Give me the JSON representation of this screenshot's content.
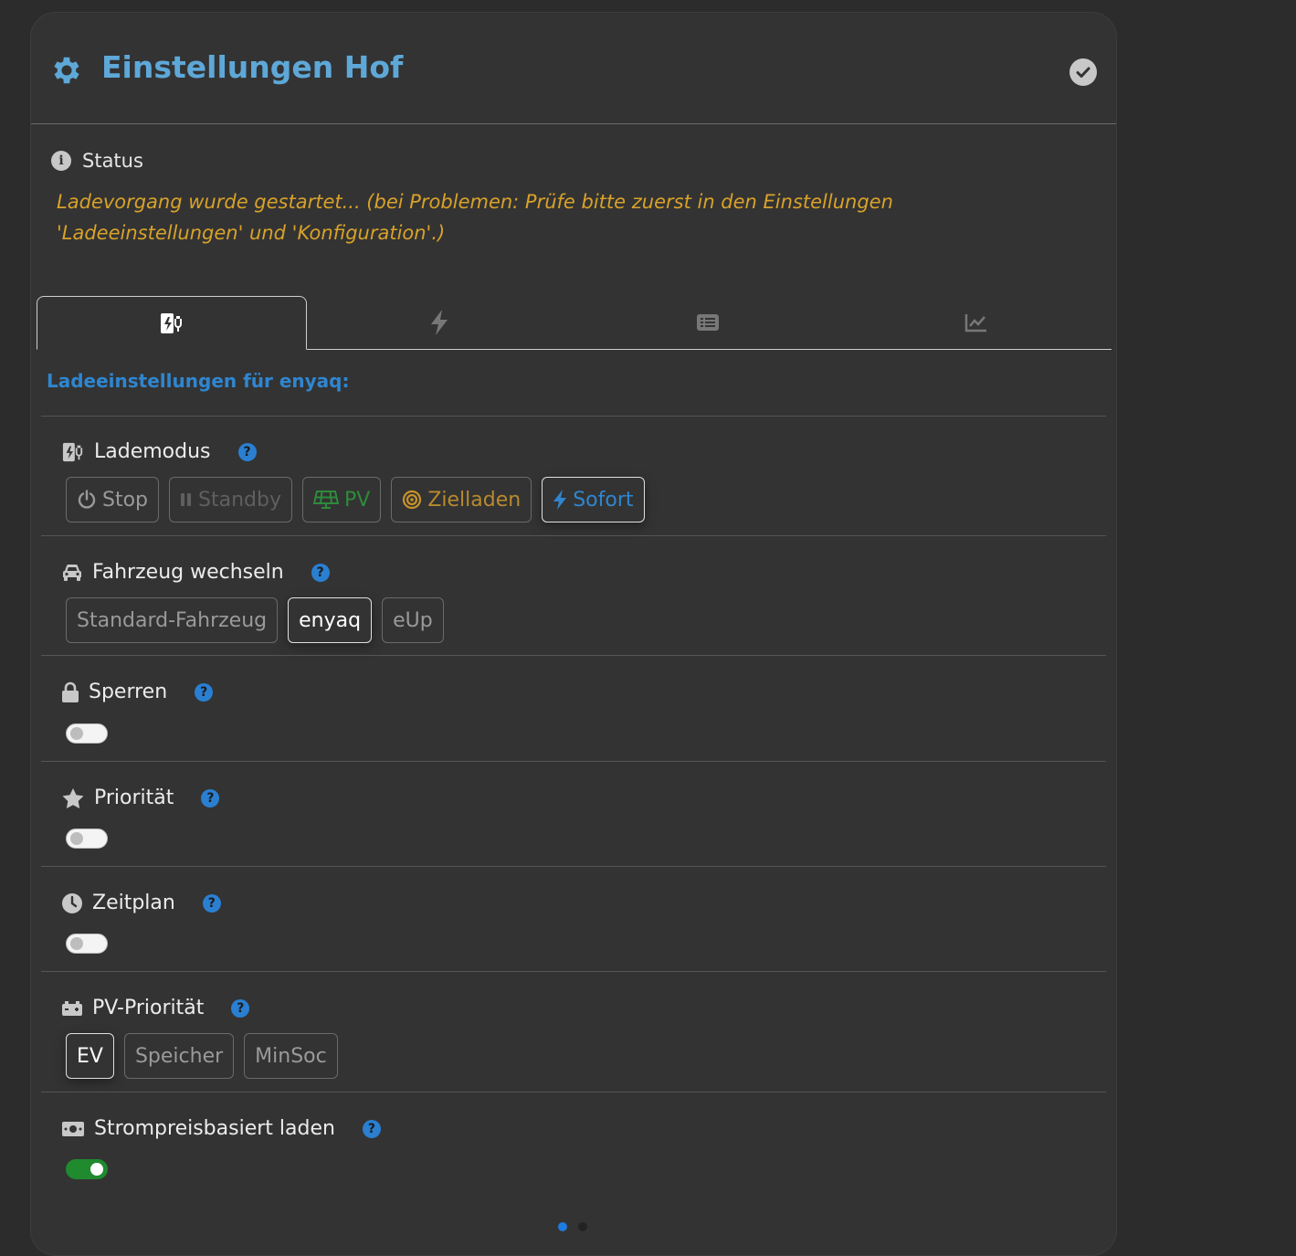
{
  "header": {
    "title": "Einstellungen Hof"
  },
  "status": {
    "label": "Status",
    "message": "Ladevorgang wurde gestartet... (bei Problemen: Prüfe bitte zuerst in den Einstellungen 'Ladeeinstellungen' und 'Konfiguration'.)"
  },
  "tabs": [
    {
      "icon": "charging-station-icon",
      "active": true
    },
    {
      "icon": "bolt-icon",
      "active": false
    },
    {
      "icon": "list-icon",
      "active": false
    },
    {
      "icon": "chart-line-icon",
      "active": false
    }
  ],
  "section_title": "Ladeeinstellungen für enyaq:",
  "lademodus": {
    "label": "Lademodus",
    "buttons": [
      "Stop",
      "Standby",
      "PV",
      "Zielladen",
      "Sofort"
    ],
    "selected": "Sofort"
  },
  "fahrzeug": {
    "label": "Fahrzeug wechseln",
    "buttons": [
      "Standard-Fahrzeug",
      "enyaq",
      "eUp"
    ],
    "selected": "enyaq"
  },
  "sperren": {
    "label": "Sperren",
    "on": false
  },
  "prioritaet": {
    "label": "Priorität",
    "on": false
  },
  "zeitplan": {
    "label": "Zeitplan",
    "on": false
  },
  "pv_prioritaet": {
    "label": "PV-Priorität",
    "buttons": [
      "EV",
      "Speicher",
      "MinSoc"
    ],
    "selected": "EV"
  },
  "strompreis": {
    "label": "Strompreisbasiert laden",
    "on": true
  },
  "help_glyph": "?",
  "info_glyph": "i",
  "colors": {
    "title": "#5ea8d8",
    "status_message": "#d8a22a",
    "section_title": "#2f86d0",
    "help": "#2a7fd1",
    "pv": "#2e8b3a",
    "zielladen": "#c8922a",
    "sofort": "#2f86d0",
    "toggle_on": "#1f8a2e"
  },
  "pager": {
    "pages": 2,
    "active": 1
  }
}
